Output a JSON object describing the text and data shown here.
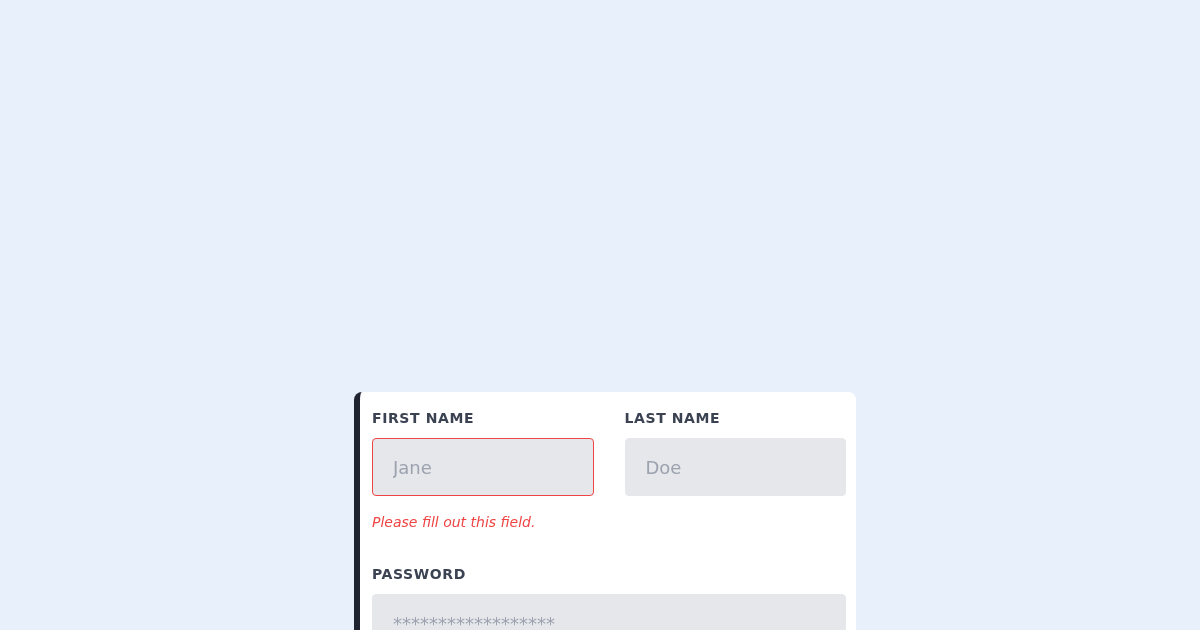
{
  "form": {
    "rows": [
      {
        "fields": [
          {
            "label": "FIRST NAME",
            "placeholder": "Jane",
            "error": true,
            "error_message": "Please fill out this field."
          },
          {
            "label": "LAST NAME",
            "placeholder": "Doe",
            "error": false
          }
        ]
      },
      {
        "fields": [
          {
            "label": "PASSWORD",
            "placeholder": "******************",
            "error": false
          }
        ]
      }
    ]
  }
}
